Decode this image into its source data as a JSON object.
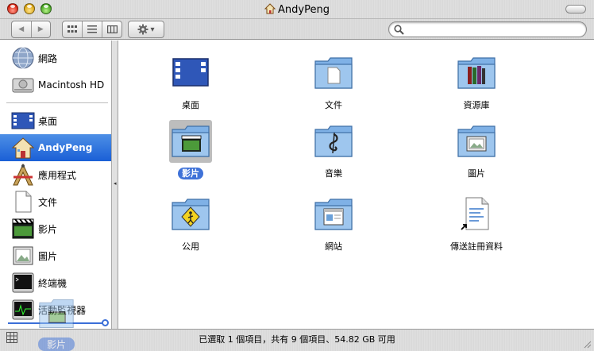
{
  "window": {
    "title": "AndyPeng"
  },
  "toolbar": {
    "back_glyph": "◀",
    "forward_glyph": "▶",
    "action_arrow": "▾",
    "search_value": ""
  },
  "sidebar": {
    "devices": [
      {
        "label": "網路",
        "icon": "network-globe-icon"
      },
      {
        "label": "Macintosh HD",
        "icon": "hard-drive-icon"
      }
    ],
    "places": [
      {
        "label": "桌面",
        "icon": "desktop-icon"
      },
      {
        "label": "AndyPeng",
        "icon": "home-icon",
        "selected": true
      },
      {
        "label": "應用程式",
        "icon": "applications-icon"
      },
      {
        "label": "文件",
        "icon": "documents-icon"
      },
      {
        "label": "影片",
        "icon": "movies-icon"
      },
      {
        "label": "圖片",
        "icon": "pictures-icon"
      },
      {
        "label": "終端機",
        "icon": "terminal-icon"
      },
      {
        "label": "活動監視器",
        "icon": "activity-monitor-icon"
      }
    ],
    "drag_ghost_label": "影片"
  },
  "files": [
    {
      "label": "桌面",
      "icon": "desktop-icon"
    },
    {
      "label": "文件",
      "icon": "documents-folder-icon"
    },
    {
      "label": "資源庫",
      "icon": "library-folder-icon"
    },
    {
      "label": "影片",
      "icon": "movies-folder-icon",
      "selected": true
    },
    {
      "label": "音樂",
      "icon": "music-folder-icon"
    },
    {
      "label": "圖片",
      "icon": "pictures-folder-icon"
    },
    {
      "label": "公用",
      "icon": "public-folder-icon"
    },
    {
      "label": "網站",
      "icon": "sites-folder-icon"
    },
    {
      "label": "傳送註冊資料",
      "icon": "registration-alias-icon"
    }
  ],
  "status": {
    "text": "已選取 1 個項目，共有 9 個項目、54.82 GB 可用"
  },
  "colors": {
    "selection": "#1a5fd6",
    "label_selection": "#3f72d8",
    "folder_blue": "#7fb1e6"
  }
}
